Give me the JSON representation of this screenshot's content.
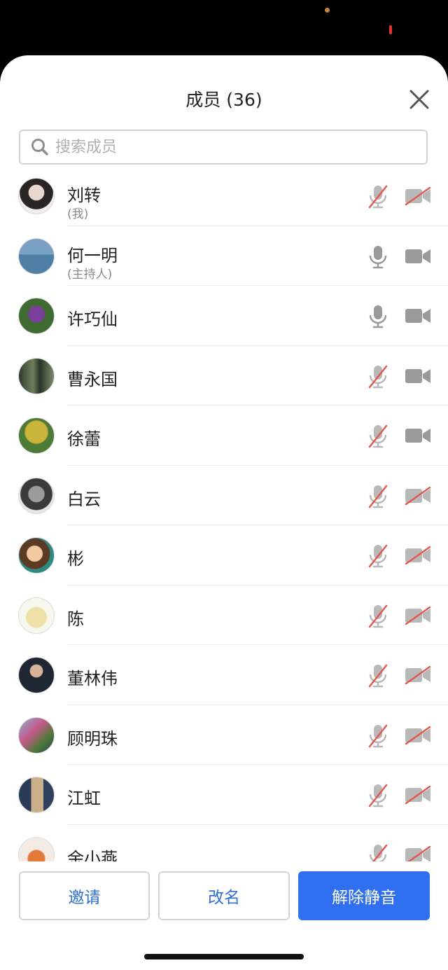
{
  "title": "成员 (36)",
  "search": {
    "placeholder": "搜索成员"
  },
  "colors": {
    "accent": "#2f6ff0",
    "muted_red": "#e05a4f",
    "icon_gray": "#9a9a9a"
  },
  "members": [
    {
      "name": "刘转",
      "role": "(我)",
      "avatar": "woman-portrait",
      "mic_muted": true,
      "cam_off": true
    },
    {
      "name": "何一明",
      "role": "(主持人)",
      "avatar": "kayak-lake",
      "mic_muted": false,
      "cam_off": false
    },
    {
      "name": "许巧仙",
      "role": "",
      "avatar": "purple-flower",
      "mic_muted": false,
      "cam_off": false
    },
    {
      "name": "曹永国",
      "role": "",
      "avatar": "forest-trees",
      "mic_muted": true,
      "cam_off": false
    },
    {
      "name": "徐蕾",
      "role": "",
      "avatar": "yellow-tree",
      "mic_muted": true,
      "cam_off": false
    },
    {
      "name": "白云",
      "role": "",
      "avatar": "badge-emblem",
      "mic_muted": true,
      "cam_off": true
    },
    {
      "name": "彬",
      "role": "",
      "avatar": "cartoon-girl",
      "mic_muted": true,
      "cam_off": true
    },
    {
      "name": "陈",
      "role": "",
      "avatar": "cartoon-chick",
      "mic_muted": true,
      "cam_off": true
    },
    {
      "name": "董林伟",
      "role": "",
      "avatar": "man-suit",
      "mic_muted": true,
      "cam_off": true
    },
    {
      "name": "顾明珠",
      "role": "",
      "avatar": "flowers-window",
      "mic_muted": true,
      "cam_off": true
    },
    {
      "name": "江虹",
      "role": "",
      "avatar": "person-doorway",
      "mic_muted": true,
      "cam_off": true
    },
    {
      "name": "余小燕",
      "role": "",
      "avatar": "orange-cup",
      "mic_muted": true,
      "cam_off": true
    }
  ],
  "footer": {
    "invite": "邀请",
    "rename": "改名",
    "unmute": "解除静音"
  }
}
